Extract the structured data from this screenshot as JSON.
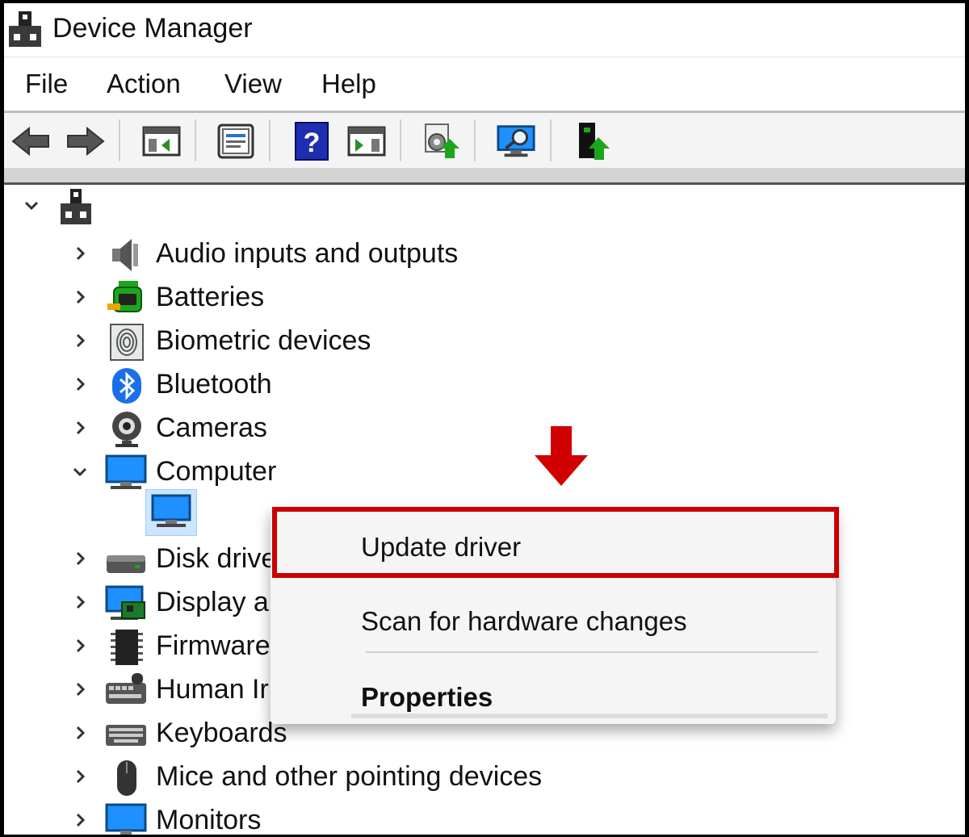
{
  "window": {
    "title": "Device Manager"
  },
  "menu": [
    "File",
    "Action",
    "View",
    "Help"
  ],
  "toolbar": {
    "buttons": [
      {
        "name": "back-arrow-icon"
      },
      {
        "name": "forward-arrow-icon"
      },
      {
        "name": "show-hide-console-tree-icon"
      },
      {
        "name": "properties-icon"
      },
      {
        "name": "help-icon",
        "glyph": "?"
      },
      {
        "name": "show-action-pane-icon"
      },
      {
        "name": "update-driver-software-icon"
      },
      {
        "name": "scan-hardware-icon"
      },
      {
        "name": "enable-device-icon"
      }
    ]
  },
  "tree": {
    "categories": [
      {
        "label": "Audio inputs and outputs",
        "icon": "speaker-icon"
      },
      {
        "label": "Batteries",
        "icon": "battery-icon"
      },
      {
        "label": "Biometric devices",
        "icon": "fingerprint-icon"
      },
      {
        "label": "Bluetooth",
        "icon": "bluetooth-icon"
      },
      {
        "label": "Cameras",
        "icon": "webcam-icon"
      },
      {
        "label": "Computer",
        "icon": "monitor-icon",
        "expanded": true
      },
      {
        "label": "Disk drive",
        "icon": "disk-drive-icon"
      },
      {
        "label": "Display a",
        "icon": "display-adapter-icon"
      },
      {
        "label": "Firmware",
        "icon": "chip-icon"
      },
      {
        "label": "Human Ir",
        "icon": "keyboard-mouse-icon"
      },
      {
        "label": "Keyboards",
        "icon": "keyboard-icon"
      },
      {
        "label": "Mice and other pointing devices",
        "icon": "mouse-icon"
      },
      {
        "label": "Monitors",
        "icon": "monitor-icon"
      }
    ]
  },
  "context_menu": {
    "items": [
      {
        "label": "Update driver",
        "highlighted": true
      },
      {
        "label": "Scan for hardware changes"
      },
      {
        "label": "Properties",
        "bold": true
      }
    ]
  },
  "colors": {
    "highlight_border": "#c80000",
    "arrow": "#d00000",
    "selection": "#cce6ff",
    "monitor_blue": "#1e90ff"
  }
}
